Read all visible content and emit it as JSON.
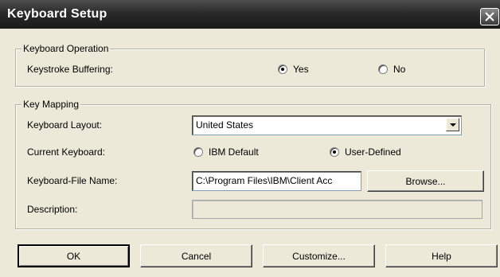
{
  "window": {
    "title": "Keyboard Setup"
  },
  "keyboard_operation": {
    "legend": "Keyboard Operation",
    "buffering_label": "Keystroke Buffering:",
    "options": [
      {
        "label": "Yes",
        "selected": true
      },
      {
        "label": "No",
        "selected": false
      }
    ]
  },
  "key_mapping": {
    "legend": "Key Mapping",
    "layout_label": "Keyboard Layout:",
    "layout_value": "United States",
    "current_label": "Current Keyboard:",
    "current_options": [
      {
        "label": "IBM Default",
        "selected": false
      },
      {
        "label": "User-Defined",
        "selected": true
      }
    ],
    "file_label": "Keyboard-File Name:",
    "file_value": "C:\\Program Files\\IBM\\Client Acc",
    "browse_label": "Browse...",
    "description_label": "Description:",
    "description_value": ""
  },
  "buttons": {
    "ok": "OK",
    "cancel": "Cancel",
    "customize": "Customize...",
    "help": "Help"
  }
}
